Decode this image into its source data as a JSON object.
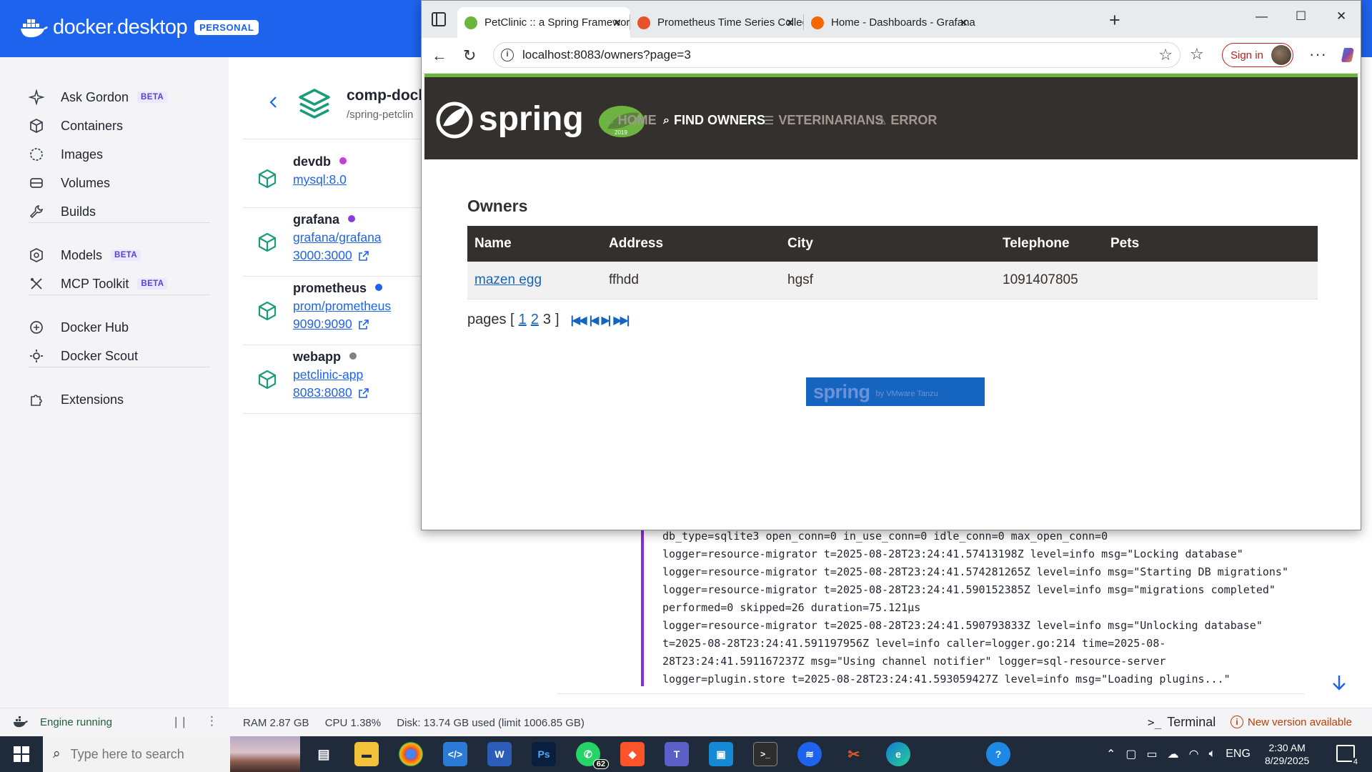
{
  "docker": {
    "brand": "docker.desktop",
    "badge": "PERSONAL",
    "nav": [
      {
        "label": "Ask Gordon",
        "beta": "BETA",
        "icon": "sparkle-icon"
      },
      {
        "label": "Containers",
        "beta": null,
        "icon": "container-cube-icon"
      },
      {
        "label": "Images",
        "beta": null,
        "icon": "images-icon"
      },
      {
        "label": "Volumes",
        "beta": null,
        "icon": "volume-disk-icon"
      },
      {
        "label": "Builds",
        "beta": null,
        "icon": "wrench-icon"
      },
      {
        "label": "Models",
        "beta": "BETA",
        "icon": "model-cube-icon"
      },
      {
        "label": "MCP Toolkit",
        "beta": "BETA",
        "icon": "toolkit-icon"
      },
      {
        "label": "Docker Hub",
        "beta": null,
        "icon": "hub-icon"
      },
      {
        "label": "Docker Scout",
        "beta": null,
        "icon": "scout-icon"
      },
      {
        "label": "Extensions",
        "beta": null,
        "icon": "puzzle-icon"
      }
    ],
    "stack": {
      "title": "comp-docl",
      "path": "/spring-petclin"
    },
    "services": [
      {
        "name": "devdb",
        "status_color": "#c73adb",
        "image": "mysql:8.0",
        "port": ""
      },
      {
        "name": "grafana",
        "status_color": "#8b3ddb",
        "image": "grafana/grafana",
        "port": "3000:3000"
      },
      {
        "name": "prometheus",
        "status_color": "#1d63ed",
        "image": "prom/prometheus",
        "port": "9090:9090"
      },
      {
        "name": "webapp",
        "status_color": "#7d828c",
        "image": "petclinic-app",
        "port": "8083:8080"
      }
    ],
    "logs": [
      "db_type=sqlite3 open_conn=0 in_use_conn=0 idle_conn=0 max_open_conn=0",
      "logger=resource-migrator t=2025-08-28T23:24:41.57413198Z level=info msg=\"Locking database\"",
      "logger=resource-migrator t=2025-08-28T23:24:41.574281265Z level=info msg=\"Starting DB migrations\"",
      "logger=resource-migrator t=2025-08-28T23:24:41.590152385Z level=info msg=\"migrations completed\"",
      "performed=0 skipped=26 duration=75.121µs",
      "logger=resource-migrator t=2025-08-28T23:24:41.590793833Z level=info msg=\"Unlocking database\"",
      "t=2025-08-28T23:24:41.591197956Z level=info caller=logger.go:214 time=2025-08-",
      "28T23:24:41.591167237Z msg=\"Using channel notifier\" logger=sql-resource-server",
      "logger=plugin.store t=2025-08-28T23:24:41.593059427Z level=info msg=\"Loading plugins...\""
    ],
    "status": {
      "engine": "Engine running",
      "ram": "RAM 2.87 GB",
      "cpu": "CPU 1.38%",
      "disk": "Disk: 13.74 GB used (limit 1006.85 GB)",
      "terminal": "Terminal",
      "new_version": "New version available"
    }
  },
  "browser": {
    "tabs": [
      {
        "title": "PetClinic :: a Spring Framework de",
        "favicon_color": "#6db33f",
        "active": true
      },
      {
        "title": "Prometheus Time Series Collectio",
        "favicon_color": "#e6522c",
        "active": false
      },
      {
        "title": "Home - Dashboards - Grafana",
        "favicon_color": "#f46800",
        "active": false
      }
    ],
    "url": "localhost:8083/owners?page=3",
    "signin": "Sign in"
  },
  "petclinic": {
    "nav": [
      {
        "label": "HOME",
        "icon": "home-icon",
        "active": false
      },
      {
        "label": "FIND OWNERS",
        "icon": "search-icon",
        "active": true
      },
      {
        "label": "VETERINARIANS",
        "icon": "list-icon",
        "active": false
      },
      {
        "label": "ERROR",
        "icon": "warning-icon",
        "active": false
      }
    ],
    "heading": "Owners",
    "columns": [
      "Name",
      "Address",
      "City",
      "Telephone",
      "Pets"
    ],
    "rows": [
      {
        "name": "mazen egg",
        "address": "ffhdd",
        "city": "hgsf",
        "telephone": "1091407805",
        "pets": ""
      }
    ],
    "pager": {
      "prefix": "pages [",
      "pages": [
        "1",
        "2"
      ],
      "current": "3",
      "suffix": "]"
    },
    "footer": {
      "logo": "spring",
      "by": "by VMware Tanzu"
    }
  },
  "taskbar": {
    "search_placeholder": "Type here to search",
    "whatsapp_badge": "62",
    "lang": "ENG",
    "time": "2:30 AM",
    "date": "8/29/2025",
    "notifications": "4"
  }
}
